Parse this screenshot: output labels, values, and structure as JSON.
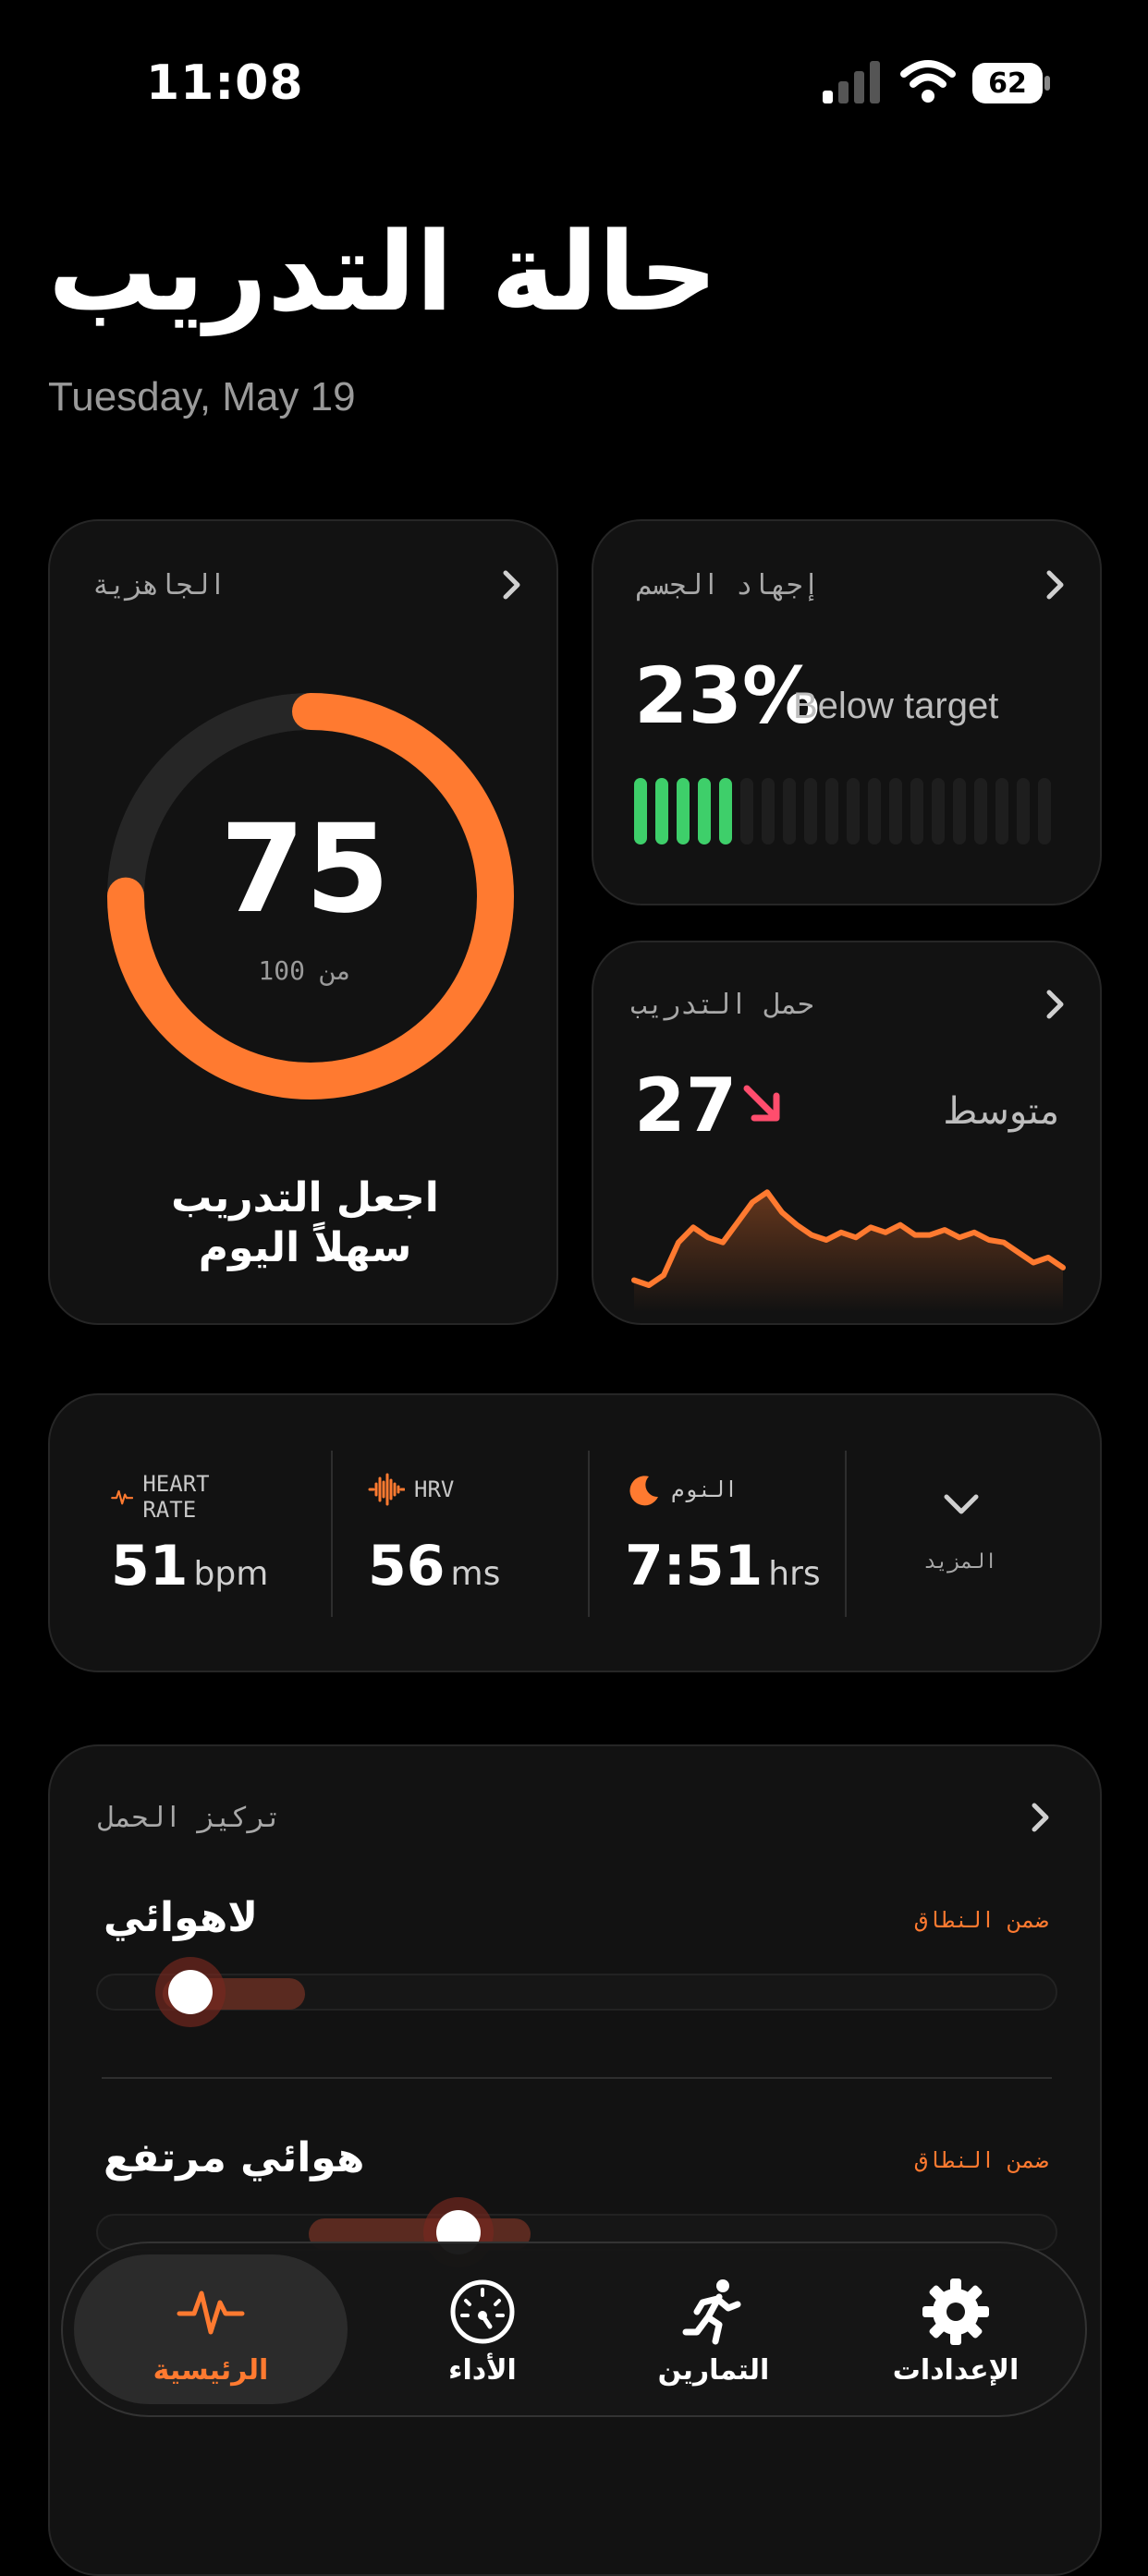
{
  "status_bar": {
    "time": "11:08",
    "battery": "62"
  },
  "header": {
    "title": "حالة التدريب",
    "date": "Tuesday, May 19"
  },
  "readiness": {
    "label": "الجاهزية",
    "score": "75",
    "score_of": "من 100",
    "score_fraction": 0.75,
    "message_line1": "اجعل التدريب",
    "message_line2": "سهلاً اليوم",
    "accent_color": "#ff7a30"
  },
  "strain": {
    "label": "إجهاد الجسم",
    "value": "23%",
    "status": "Below target",
    "segments_total": 20,
    "segments_filled": 5,
    "fill_color": "#3ecf6a"
  },
  "training_load": {
    "label": "حمل التدريب",
    "value": "27",
    "trend": "down",
    "level": "متوسط",
    "series": [
      18,
      14,
      22,
      48,
      60,
      52,
      48,
      64,
      80,
      88,
      72,
      62,
      54,
      50,
      56,
      52,
      60,
      56,
      62,
      54,
      54,
      58,
      52,
      56,
      50,
      48,
      40,
      32,
      36,
      28
    ]
  },
  "vitals": {
    "heart_rate": {
      "label": "HEART RATE",
      "value": "51",
      "unit": "bpm"
    },
    "hrv": {
      "label": "HRV",
      "value": "56",
      "unit": "ms"
    },
    "sleep": {
      "label": "النوم",
      "value": "7:51",
      "unit": "hrs"
    },
    "more_label": "المزيد"
  },
  "load_focus": {
    "label": "تركيز الحمل",
    "rows": [
      {
        "name": "لاهوائي",
        "status": "ضمن النطاق"
      },
      {
        "name": "هوائي مرتفع",
        "status": "ضمن النطاق"
      }
    ]
  },
  "tab_bar": {
    "items": [
      {
        "label": "الرئيسية",
        "icon": "heartbeat-icon",
        "active": true
      },
      {
        "label": "الأداء",
        "icon": "gauge-icon",
        "active": false
      },
      {
        "label": "التمارين",
        "icon": "running-person-icon",
        "active": false
      },
      {
        "label": "الإعدادات",
        "icon": "gear-icon",
        "active": false
      }
    ]
  }
}
